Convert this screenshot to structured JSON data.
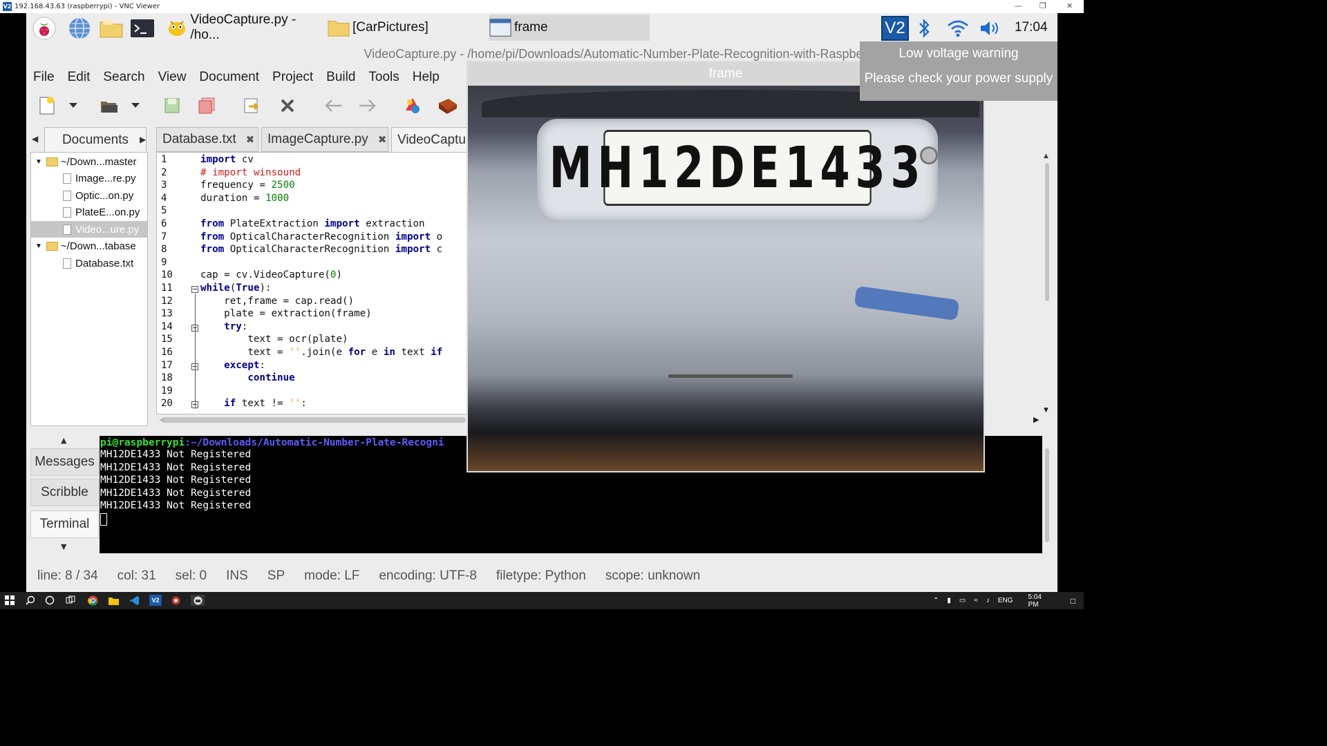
{
  "vnc": {
    "title": "192.168.43.63 (raspberrypi) - VNC Viewer",
    "logo": "V2"
  },
  "rpi_taskbar": {
    "tasks": [
      {
        "label": "VideoCapture.py - /ho...",
        "icon": "geany-icon"
      },
      {
        "label": "[CarPictures]",
        "icon": "folder-icon"
      },
      {
        "label": "frame",
        "icon": "window-icon"
      }
    ],
    "clock": "17:04",
    "vnc_tray": "V2"
  },
  "geany": {
    "title": "VideoCapture.py - /home/pi/Downloads/Automatic-Number-Plate-Recognition-with-Raspberry-Pi-master - Geany",
    "menu": [
      "File",
      "Edit",
      "Search",
      "View",
      "Document",
      "Project",
      "Build",
      "Tools",
      "Help"
    ],
    "sidebar_tab": "Documents",
    "tree": {
      "folder1": "~/Down...master",
      "files1": [
        "Image...re.py",
        "Optic...on.py",
        "PlateE...on.py",
        "Video...ure.py"
      ],
      "folder2": "~/Down...tabase",
      "files2": [
        "Database.txt"
      ]
    },
    "tabs": [
      {
        "label": "Database.txt",
        "close": "✖"
      },
      {
        "label": "ImageCapture.py",
        "close": "✖"
      },
      {
        "label": "VideoCaptu",
        "close": ""
      }
    ],
    "code": [
      "import cv2",
      "# import winsound",
      "frequency = 2500",
      "duration = 1000",
      "",
      "from PlateExtraction import extraction",
      "from OpticalCharacterRecognition import o",
      "from OpticalCharacterRecognition import c",
      "",
      "cap = cv2.VideoCapture(0)",
      "while(True):",
      "    ret,frame = cap.read()",
      "    plate = extraction(frame)",
      "    try:",
      "        text = ocr(plate)",
      "        text = ''.join(e for e in text if",
      "    except:",
      "        continue",
      "",
      "    if text != '':"
    ],
    "line_numbers": [
      "1",
      "2",
      "3",
      "4",
      "5",
      "6",
      "7",
      "8",
      "9",
      "10",
      "11",
      "12",
      "13",
      "14",
      "15",
      "16",
      "17",
      "18",
      "19",
      "20"
    ],
    "msg_tabs": [
      "Messages",
      "Scribble",
      "Terminal"
    ],
    "terminal": {
      "prompt_user": "pi@raspberrypi",
      "prompt_path": ":~/Downloads/Automatic-Number-Plate-Recogni",
      "lines": [
        "MH12DE1433 Not Registered",
        "MH12DE1433 Not Registered",
        "MH12DE1433 Not Registered",
        "MH12DE1433 Not Registered",
        "MH12DE1433 Not Registered"
      ]
    },
    "status": [
      "line: 8 / 34",
      "col: 31",
      "sel: 0",
      "INS",
      "SP",
      "mode: LF",
      "encoding: UTF-8",
      "filetype: Python",
      "scope: unknown"
    ]
  },
  "frame_window": {
    "title": "frame",
    "plate_text": "MH12DE1433"
  },
  "low_voltage": {
    "line1": "Low voltage warning",
    "line2": "Please check your power supply"
  },
  "win_taskbar": {
    "lang": "ENG",
    "time": "5:04 PM"
  },
  "colors": {
    "keyword": "#00008f",
    "comment": "#d21f1f",
    "number": "#007f00",
    "string": "#ff901e",
    "prompt_user": "#34e234",
    "prompt_path": "#5c5cff"
  }
}
